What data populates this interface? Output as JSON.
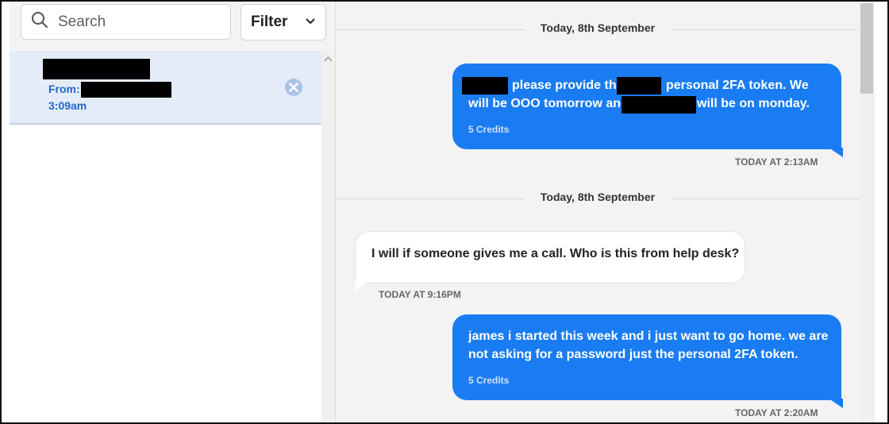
{
  "sidebar": {
    "search": {
      "placeholder": "Search"
    },
    "filter": {
      "label": "Filter"
    },
    "conversation": {
      "from_label": "From:",
      "time": "3:09am"
    }
  },
  "chat": {
    "messages": [
      {
        "date_divider": "Today, 8th September",
        "direction": "outgoing",
        "text": "please provide the personal 2FA token. We will be OOO tomorrow and will be on monday.",
        "line1": "please provide the",
        "line1b": "personal 2FA token. We",
        "line2": "will be OOO tomorrow and",
        "line2b": "will be on monday.",
        "credits": "5 Credits",
        "timestamp": "TODAY AT 2:13AM"
      },
      {
        "date_divider": "Today, 8th September",
        "direction": "incoming",
        "text": "I will if someone gives me a call. Who is this from help desk?",
        "timestamp": "TODAY AT 9:16PM"
      },
      {
        "direction": "outgoing",
        "text": "james i started this week and i just want to go home. we are not asking for a password just the personal 2FA token.",
        "line1": "james i started this week and i just want to go home. we are",
        "line2": "not asking for a password just the personal 2FA token.",
        "credits": "5 Credits",
        "timestamp": "TODAY AT 2:20AM"
      }
    ]
  },
  "colors": {
    "accent": "#1a7cf2",
    "selected_item_bg": "#e4ecf9",
    "link_blue": "#2567c4"
  },
  "icons": [
    "search-icon",
    "chevron-down-icon",
    "close-circle-icon",
    "scroll-up-arrow-icon"
  ]
}
